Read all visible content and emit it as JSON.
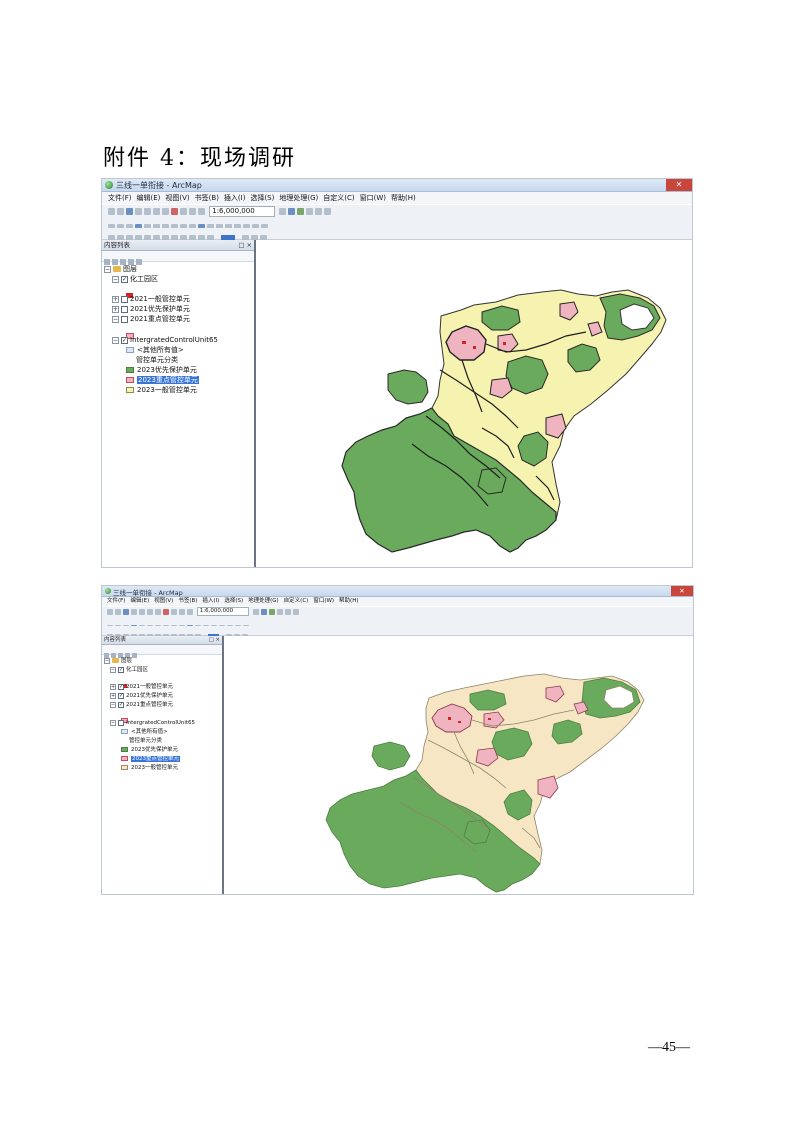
{
  "page": {
    "heading": "附件 4：现场调研",
    "page_number": "—45—"
  },
  "colors": {
    "priority_protect": "#6aaa5c",
    "key_control": "#f0b4c0",
    "general_control_yellow": "#f6f3b1",
    "general_control_beige": "#f6e6c4",
    "chem_park": "#d42222",
    "selection": "#3875d7"
  },
  "screenshot1": {
    "window_title": "三线一单衔接 - ArcMap",
    "menu": [
      "文件(F)",
      "编辑(E)",
      "视图(V)",
      "书签(B)",
      "插入(I)",
      "选择(S)",
      "地理处理(G)",
      "自定义(C)",
      "窗口(W)",
      "帮助(H)"
    ],
    "scale": "1:6,000,000",
    "toc_title": "内容列表",
    "toc_controls": "□ ×",
    "layers": {
      "root": "图层",
      "chem_park": "化工园区",
      "general_2021": "2021一般管控单元",
      "priority_2021": "2021优先保护单元",
      "key_2021": "2021重点管控单元",
      "icu": "IntergratedControlUnit65",
      "other_values": "<其他所有值>",
      "classification": "管控单元分类",
      "priority_2023": "2023优先保护单元",
      "key_2023": "2023重点管控单元",
      "general_2023": "2023一般管控单元"
    }
  },
  "screenshot2": {
    "window_title": "三线一单衔接 - ArcMap",
    "menu": [
      "文件(F)",
      "编辑(E)",
      "视图(V)",
      "书签(B)",
      "插入(I)",
      "选择(S)",
      "地理处理(G)",
      "自定义(C)",
      "窗口(W)",
      "帮助(H)"
    ],
    "scale": "1:6,000,000",
    "toc_title": "内容列表",
    "toc_controls": "□ ×",
    "layers": {
      "root": "图层",
      "chem_park": "化工园区",
      "general_2021": "2021一般管控单元",
      "priority_2021": "2021优先保护单元",
      "key_2021": "2021重点管控单元",
      "icu": "IntergratedControlUnit65",
      "other_values": "<其他所有值>",
      "classification": "管控单元分类",
      "priority_2023": "2023优先保护单元",
      "key_2023": "2023重点管控单元",
      "general_2023": "2023一般管控单元"
    }
  }
}
